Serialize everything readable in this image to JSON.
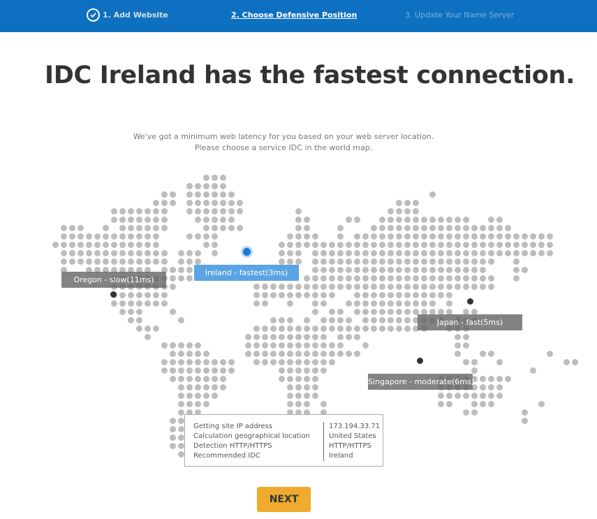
{
  "steps": [
    {
      "label": "1. Add Website",
      "state": "done",
      "icon": "check-circle-icon"
    },
    {
      "label": "2. Choose Defensive Position",
      "state": "current"
    },
    {
      "label": "3. Update Your Name Server",
      "state": "upcoming"
    }
  ],
  "headline": {
    "bold": "IDC Ireland",
    "rest": " has the fastest connection."
  },
  "subtitle": {
    "line1": "We've got a minimum web latency for you based on your web server location.",
    "line2": "Please choose a service IDC in the world map."
  },
  "idcs": [
    {
      "name": "Oregon",
      "label": "Oregon - slow(11ms)",
      "speed": "slow",
      "latency_ms": 11,
      "selected": false
    },
    {
      "name": "Ireland",
      "label": "Ireland - fastest(3ms)",
      "speed": "fastest",
      "latency_ms": 3,
      "selected": true
    },
    {
      "name": "Japan",
      "label": "Japan - fast(5ms)",
      "speed": "fast",
      "latency_ms": 5,
      "selected": false
    },
    {
      "name": "Singapore",
      "label": "Singapore - moderate(6ms)",
      "speed": "moderate",
      "latency_ms": 6,
      "selected": false
    }
  ],
  "info": {
    "rows": [
      {
        "label": "Getting site IP address",
        "value": "173.194.33.71"
      },
      {
        "label": "Calculation geographical location",
        "value": "United States"
      },
      {
        "label": "Detection HTTP/HTTPS",
        "value": "HTTP/HTTPS"
      },
      {
        "label": "Recommended IDC",
        "value": "Ireland"
      }
    ]
  },
  "next_button": {
    "label": "NEXT"
  },
  "colors": {
    "header": "#0e70c0",
    "accent": "#1a7ad6",
    "button": "#f0ab2e",
    "dot": "#bdbdbd"
  }
}
